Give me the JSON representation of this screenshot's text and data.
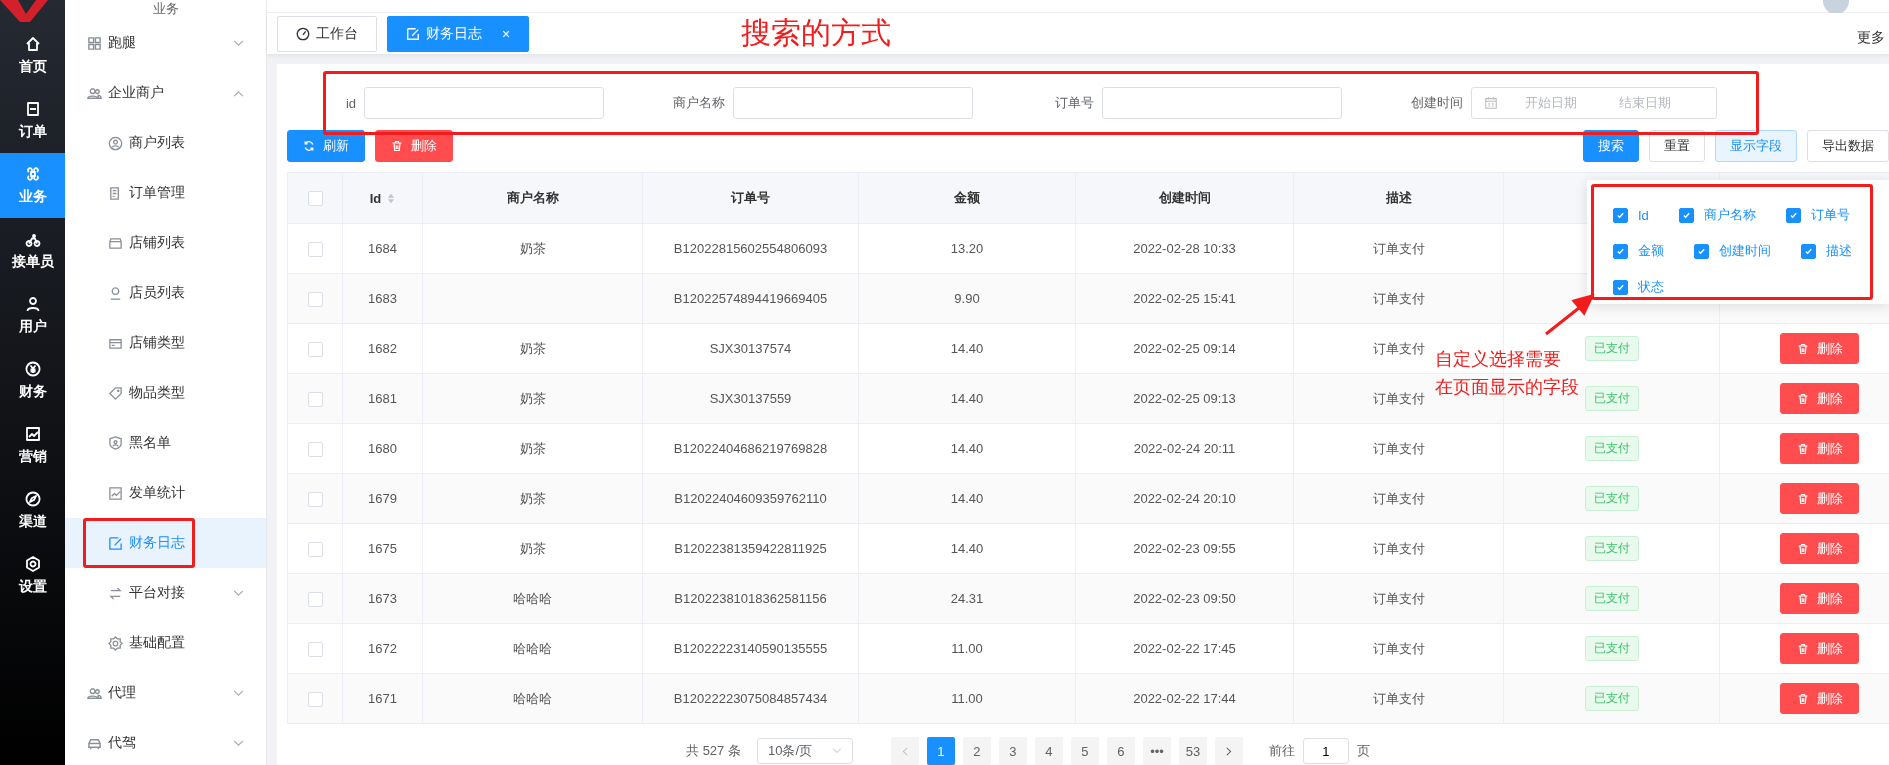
{
  "rail": {
    "items": [
      {
        "label": "首页",
        "selected": false
      },
      {
        "label": "订单",
        "selected": false
      },
      {
        "label": "业务",
        "selected": true
      },
      {
        "label": "接单员",
        "selected": false
      },
      {
        "label": "用户",
        "selected": false
      },
      {
        "label": "财务",
        "selected": false
      },
      {
        "label": "营销",
        "selected": false
      },
      {
        "label": "渠道",
        "selected": false
      },
      {
        "label": "设置",
        "selected": false
      }
    ]
  },
  "submenu": {
    "title": "业务",
    "items": [
      {
        "label": "跑腿",
        "selected": false,
        "expanded": false
      },
      {
        "label": "企业商户",
        "selected": false,
        "expanded": true,
        "children": [
          {
            "label": "商户列表",
            "selected": false
          },
          {
            "label": "订单管理",
            "selected": false
          },
          {
            "label": "店铺列表",
            "selected": false
          },
          {
            "label": "店员列表",
            "selected": false
          },
          {
            "label": "店铺类型",
            "selected": false
          },
          {
            "label": "物品类型",
            "selected": false
          },
          {
            "label": "黑名单",
            "selected": false
          },
          {
            "label": "发单统计",
            "selected": false
          },
          {
            "label": "财务日志",
            "selected": true
          },
          {
            "label": "平台对接",
            "selected": false,
            "expanded": false
          },
          {
            "label": "基础配置",
            "selected": false
          }
        ]
      },
      {
        "label": "代理",
        "selected": false,
        "expanded": false
      },
      {
        "label": "代驾",
        "selected": false,
        "expanded": false
      }
    ]
  },
  "tabs": [
    {
      "label": "工作台",
      "selected": false
    },
    {
      "label": "财务日志",
      "selected": true,
      "close": "×"
    }
  ],
  "more": "更多",
  "annotation": {
    "title": "搜索的方式",
    "note": [
      "自定义选择需要",
      "在页面显示的字段"
    ]
  },
  "search": {
    "fields": [
      {
        "label": "id",
        "kind": "text"
      },
      {
        "label": "商户名称",
        "kind": "text"
      },
      {
        "label": "订单号",
        "kind": "text"
      },
      {
        "label": "创建时间",
        "kind": "daterange",
        "start_placeholder": "开始日期",
        "end_placeholder": "结束日期"
      }
    ]
  },
  "toolbar": {
    "left": [
      {
        "label": "刷新",
        "kind": "primary"
      },
      {
        "label": "删除",
        "kind": "danger"
      }
    ],
    "right": [
      {
        "label": "搜索",
        "kind": "primary"
      },
      {
        "label": "重置",
        "kind": "default"
      },
      {
        "label": "显示字段",
        "kind": "plain"
      },
      {
        "label": "导出数据",
        "kind": "default"
      }
    ]
  },
  "table": {
    "header_checked": false,
    "columns": [
      {
        "label": "Id",
        "sortable": true
      },
      {
        "label": "商户名称",
        "sortable": false
      },
      {
        "label": "订单号",
        "sortable": false
      },
      {
        "label": "金额",
        "sortable": false
      },
      {
        "label": "创建时间",
        "sortable": false
      },
      {
        "label": "描述",
        "sortable": false
      }
    ],
    "rows": [
      {
        "checked": false,
        "id": "1684",
        "merchant": "奶茶",
        "order": "B12022815602554806093",
        "amount": "13.20",
        "created": "2022-02-28 10:33",
        "desc": "订单支付"
      },
      {
        "checked": false,
        "id": "1683",
        "order": "B12022574894419669405",
        "amount": "9.90",
        "created": "2022-02-25 15:41",
        "desc": "订单支付"
      },
      {
        "checked": false,
        "id": "1682",
        "merchant": "奶茶",
        "order": "SJX30137574",
        "amount": "14.40",
        "created": "2022-02-25 09:14",
        "desc": "订单支付",
        "status": "已支付",
        "action": "删除"
      },
      {
        "checked": false,
        "id": "1681",
        "merchant": "奶茶",
        "order": "SJX30137559",
        "amount": "14.40",
        "created": "2022-02-25 09:13",
        "desc": "订单支付",
        "status": "已支付",
        "action": "删除"
      },
      {
        "checked": false,
        "id": "1680",
        "merchant": "奶茶",
        "order": "B12022404686219769828",
        "amount": "14.40",
        "created": "2022-02-24 20:11",
        "desc": "订单支付",
        "status": "已支付",
        "action": "删除"
      },
      {
        "checked": false,
        "id": "1679",
        "merchant": "奶茶",
        "order": "B12022404609359762110",
        "amount": "14.40",
        "created": "2022-02-24 20:10",
        "desc": "订单支付",
        "status": "已支付",
        "action": "删除"
      },
      {
        "checked": false,
        "id": "1675",
        "merchant": "奶茶",
        "order": "B12022381359422811925",
        "amount": "14.40",
        "created": "2022-02-23 09:55",
        "desc": "订单支付",
        "status": "已支付",
        "action": "删除"
      },
      {
        "checked": false,
        "id": "1673",
        "merchant": "哈哈哈",
        "order": "B12022381018362581156",
        "amount": "24.31",
        "created": "2022-02-23 09:50",
        "desc": "订单支付",
        "status": "已支付",
        "action": "删除"
      },
      {
        "checked": false,
        "id": "1672",
        "merchant": "哈哈哈",
        "order": "B12022223140590135555",
        "amount": "11.00",
        "created": "2022-02-22 17:45",
        "desc": "订单支付",
        "status": "已支付",
        "action": "删除"
      },
      {
        "checked": false,
        "id": "1671",
        "merchant": "哈哈哈",
        "order": "B12022223075084857434",
        "amount": "11.00",
        "created": "2022-02-22 17:44",
        "desc": "订单支付",
        "status": "已支付",
        "action": "删除"
      }
    ]
  },
  "field_picker": {
    "options": [
      {
        "label": "Id",
        "checked": true
      },
      {
        "label": "商户名称",
        "checked": true
      },
      {
        "label": "订单号",
        "checked": true
      },
      {
        "label": "金额",
        "checked": true
      },
      {
        "label": "创建时间",
        "checked": true
      },
      {
        "label": "描述",
        "checked": true
      },
      {
        "label": "状态",
        "checked": true
      }
    ]
  },
  "pagination": {
    "total": "共 527 条",
    "page_size": "10条/页",
    "pages": [
      {
        "label": "1",
        "selected": true
      },
      {
        "label": "2",
        "selected": false
      },
      {
        "label": "3",
        "selected": false
      },
      {
        "label": "4",
        "selected": false
      },
      {
        "label": "5",
        "selected": false
      },
      {
        "label": "6",
        "selected": false
      },
      {
        "label": "•••",
        "selected": false
      },
      {
        "label": "53",
        "selected": false
      }
    ],
    "goto_label": "前往",
    "goto_value": "1",
    "page_suffix": "页"
  }
}
